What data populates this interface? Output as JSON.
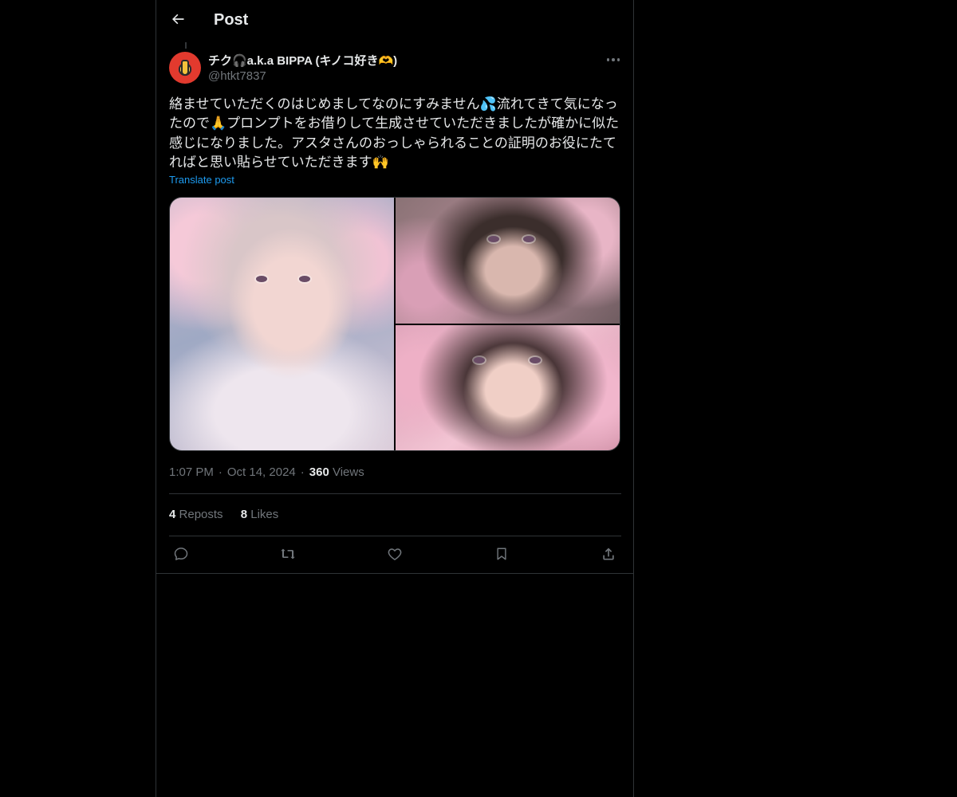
{
  "header": {
    "title": "Post",
    "back_icon": "arrow-left-icon"
  },
  "author": {
    "display_name": "チク🎧a.k.a BIPPA (キノコ好き🫶)",
    "handle": "@htkt7837",
    "avatar_icon": "avatar"
  },
  "post": {
    "text": "絡ませていただくのはじめましてなのにすみません💦流れてきて気になっ\nたので🙏プロンプトをお借りして生成させていただきましたが確かに似た\n感じになりました。アスタさんのおっしゃられることの証明のお役にたて\nればと思い貼らせていただきます🙌",
    "translate_label": "Translate post"
  },
  "media": {
    "images": [
      "image-1",
      "image-2",
      "image-3"
    ]
  },
  "meta": {
    "time": "1:07 PM",
    "separator": "·",
    "date": "Oct 14, 2024",
    "views_count": "360",
    "views_label": "Views"
  },
  "stats": {
    "reposts_count": "4",
    "reposts_label": "Reposts",
    "likes_count": "8",
    "likes_label": "Likes"
  },
  "actions": {
    "icons": [
      "reply-icon",
      "repost-icon",
      "like-icon",
      "bookmark-icon",
      "share-icon"
    ]
  },
  "colors": {
    "background": "#000000",
    "text_primary": "#e7e9ea",
    "text_secondary": "#71767b",
    "accent": "#1d9bf0",
    "border": "#2f3336"
  }
}
